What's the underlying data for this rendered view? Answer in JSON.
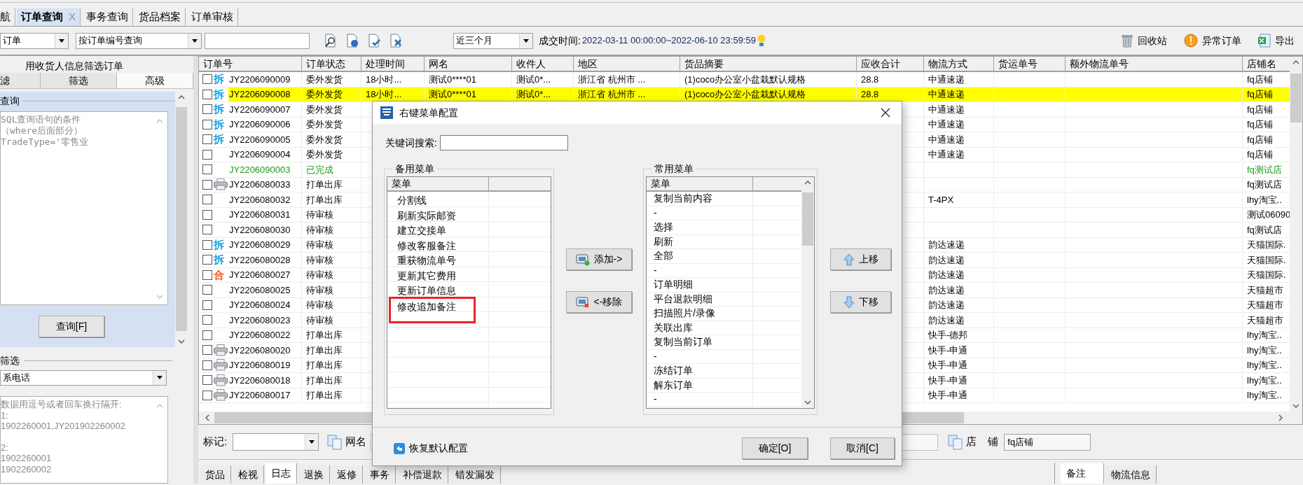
{
  "tabs": [
    {
      "label": "航",
      "selected": false
    },
    {
      "label": "订单查询",
      "selected": true,
      "close": "X"
    },
    {
      "label": "事务查询",
      "selected": false
    },
    {
      "label": "货品档案",
      "selected": false
    },
    {
      "label": "订单审核",
      "selected": false
    }
  ],
  "toolbar": {
    "scope": "订单",
    "query_mode": "按订单编号查询",
    "period": "近三个月",
    "time_label": "成交时间:",
    "time_range": "2022-03-11 00:00:00~2022-06-10 23:59:59",
    "actions": [
      {
        "kind": "trash",
        "label": "回收站"
      },
      {
        "kind": "warning",
        "label": "异常订单"
      },
      {
        "kind": "export",
        "label": "导出"
      }
    ]
  },
  "filter_panel": {
    "title": "用收货人信息筛选订单",
    "tabs": [
      {
        "label": "滤",
        "selected": false
      },
      {
        "label": "筛选",
        "selected": false
      },
      {
        "label": "高级",
        "selected": true
      }
    ],
    "query_title": "查询",
    "query_hint": [
      "SQL查询语句的条件",
      "（where后面部分）",
      "TradeType='零售业"
    ],
    "query_button": "查询[F]",
    "filter_title": "筛选",
    "filter_field": "系电话",
    "filter_hint": [
      [
        "数据用逗号或者回车换行隔开:",
        "1:",
        "1902260001,JY201902260002"
      ],
      [
        "2:",
        "1902260001",
        "1902260002"
      ]
    ]
  },
  "table": {
    "columns": [
      "订单号",
      "订单状态",
      "处理时间",
      "网名",
      "收件人",
      "地区",
      "货品摘要",
      "应收合计",
      "物流方式",
      "货运单号",
      "额外物流单号",
      "店铺名"
    ],
    "rows": [
      {
        "checked": false,
        "selected": false,
        "printed": false,
        "completed": false,
        "tag": {
          "text": "拆",
          "color": "#1ba1e2"
        },
        "order_no": "JY2206090009",
        "status": "委外发货",
        "time": "18小时...",
        "nickname": "测试0****01",
        "receiver": "测试0*...",
        "region": "浙江省 杭州市 ...",
        "goods": "(1)coco办公室小盆栽默认规格",
        "amount": "28.8",
        "shipping": "中通速递",
        "store": "fq店铺"
      },
      {
        "checked": false,
        "selected": true,
        "printed": false,
        "completed": false,
        "tag": {
          "text": "拆",
          "color": "#1ba1e2"
        },
        "order_no": "JY2206090008",
        "status": "委外发货",
        "time": "18小时...",
        "nickname": "测试0****01",
        "receiver": "测试0*...",
        "region": "浙江省 杭州市 ...",
        "goods": "(1)coco办公室小盆栽默认规格",
        "amount": "28.8",
        "shipping": "中通速递",
        "store": "fq店铺"
      },
      {
        "checked": false,
        "selected": false,
        "printed": false,
        "completed": false,
        "tag": {
          "text": "拆",
          "color": "#1ba1e2"
        },
        "order_no": "JY2206090007",
        "status": "委外发货",
        "shipping": "中通速递",
        "store": "fq店铺"
      },
      {
        "checked": false,
        "selected": false,
        "printed": false,
        "completed": false,
        "tag": {
          "text": "拆",
          "color": "#1ba1e2"
        },
        "order_no": "JY2206090006",
        "status": "委外发货",
        "shipping": "中通速递",
        "store": "fq店铺"
      },
      {
        "checked": false,
        "selected": false,
        "printed": false,
        "completed": false,
        "tag": {
          "text": "拆",
          "color": "#1ba1e2"
        },
        "order_no": "JY2206090005",
        "status": "委外发货",
        "shipping": "中通速递",
        "store": "fq店铺"
      },
      {
        "checked": false,
        "selected": false,
        "printed": false,
        "completed": false,
        "order_no": "JY2206090004",
        "status": "委外发货",
        "shipping": "中通速递",
        "store": "fq店铺"
      },
      {
        "checked": false,
        "selected": false,
        "printed": false,
        "completed": true,
        "order_no": "JY2206090003",
        "status": "已完成",
        "store": "fq测试店"
      },
      {
        "checked": false,
        "selected": false,
        "printed": true,
        "completed": false,
        "order_no": "JY2206080033",
        "status": "打单出库",
        "store": "fq测试店"
      },
      {
        "checked": false,
        "selected": false,
        "printed": false,
        "completed": false,
        "order_no": "JY2206080032",
        "status": "打单出库",
        "shipping": "T-4PX",
        "store": "lhy淘宝.."
      },
      {
        "checked": false,
        "selected": false,
        "printed": false,
        "completed": false,
        "order_no": "JY2206080031",
        "status": "待审核",
        "store": "测试06090"
      },
      {
        "checked": false,
        "selected": false,
        "printed": false,
        "completed": false,
        "order_no": "JY2206080030",
        "status": "待审核",
        "store": "fq测试店"
      },
      {
        "checked": false,
        "selected": false,
        "printed": false,
        "completed": false,
        "tag": {
          "text": "拆",
          "color": "#1ba1e2"
        },
        "order_no": "JY2206080029",
        "status": "待审核",
        "shipping": "韵达速递",
        "store": "天猫国际."
      },
      {
        "checked": false,
        "selected": false,
        "printed": false,
        "completed": false,
        "tag": {
          "text": "拆",
          "color": "#1ba1e2"
        },
        "order_no": "JY2206080028",
        "status": "待审核",
        "shipping": "韵达速递",
        "store": "天猫国际."
      },
      {
        "checked": false,
        "selected": false,
        "printed": false,
        "completed": false,
        "tag": {
          "text": "合",
          "color": "#f05a28"
        },
        "order_no": "JY2206080027",
        "status": "待审核",
        "shipping": "韵达速递",
        "store": "天猫国际."
      },
      {
        "checked": false,
        "selected": false,
        "printed": false,
        "completed": false,
        "order_no": "JY2206080025",
        "status": "待审核",
        "shipping": "韵达速递",
        "store": "天猫超市"
      },
      {
        "checked": false,
        "selected": false,
        "printed": false,
        "completed": false,
        "order_no": "JY2206080024",
        "status": "待审核",
        "shipping": "韵达速递",
        "store": "天猫超市"
      },
      {
        "checked": false,
        "selected": false,
        "printed": false,
        "completed": false,
        "order_no": "JY2206080023",
        "status": "待审核",
        "shipping": "韵达速递",
        "store": "天猫超市"
      },
      {
        "checked": false,
        "selected": false,
        "printed": false,
        "completed": false,
        "order_no": "JY2206080022",
        "status": "打单出库",
        "shipping": "快手-德邦",
        "store": "lhy淘宝.."
      },
      {
        "checked": false,
        "selected": false,
        "printed": true,
        "completed": false,
        "order_no": "JY2206080020",
        "status": "打单出库",
        "shipping": "快手-申通",
        "store": "lhy淘宝.."
      },
      {
        "checked": false,
        "selected": false,
        "printed": true,
        "completed": false,
        "order_no": "JY2206080019",
        "status": "打单出库",
        "shipping": "快手-申通",
        "store": "lhy淘宝.."
      },
      {
        "checked": false,
        "selected": false,
        "printed": true,
        "completed": false,
        "order_no": "JY2206080018",
        "status": "打单出库",
        "shipping": "快手-申通",
        "store": "lhy淘宝.."
      },
      {
        "checked": false,
        "selected": false,
        "printed": true,
        "completed": false,
        "order_no": "JY2206080017",
        "status": "打单出库",
        "shipping": "快手-申通",
        "store": "lhy淘宝.."
      }
    ]
  },
  "detail_bar": {
    "mark_label": "标记:",
    "nickname_label": "网名",
    "store_label": "店 铺",
    "store_value": "fq店铺"
  },
  "bottom_tabs": [
    {
      "label": "货品",
      "selected": false
    },
    {
      "label": "检视",
      "selected": false
    },
    {
      "label": "日志",
      "selected": true
    },
    {
      "label": "退换",
      "selected": false
    },
    {
      "label": "返修",
      "selected": false
    },
    {
      "label": "事务",
      "selected": false
    },
    {
      "label": "补偿退款",
      "selected": false
    },
    {
      "label": "错发漏发",
      "selected": false
    }
  ],
  "side_tabs": [
    {
      "label": "备注",
      "selected": true
    },
    {
      "label": "物流信息",
      "selected": false
    }
  ],
  "dialog": {
    "title": "右键菜单配置",
    "keyword_label": "关键词搜索:",
    "spare_title": "备用菜单",
    "spare_header": "菜单",
    "spare_items": [
      {
        "label": "分割线",
        "highlighted": false
      },
      {
        "label": "刷新实际邮资",
        "highlighted": false
      },
      {
        "label": "建立交接单",
        "highlighted": false
      },
      {
        "label": "修改客服备注",
        "highlighted": false
      },
      {
        "label": "重获物流单号",
        "highlighted": false
      },
      {
        "label": "更新其它费用",
        "highlighted": false
      },
      {
        "label": "更新订单信息",
        "highlighted": false
      },
      {
        "label": "修改追加备注",
        "highlighted": true
      }
    ],
    "transfer_buttons": [
      {
        "kind": "add",
        "label": "添加->"
      },
      {
        "kind": "remove",
        "label": "<-移除"
      }
    ],
    "common_title": "常用菜单",
    "common_header": "菜单",
    "common_items": [
      "复制当前内容",
      "-",
      "选择",
      "刷新",
      "全部",
      "-",
      "订单明细",
      "平台退款明细",
      "扫描照片/录像",
      "关联出库",
      "复制当前订单",
      "-",
      "冻结订单",
      "解东订单",
      "-"
    ],
    "order_buttons": [
      {
        "kind": "up",
        "label": "上移"
      },
      {
        "kind": "down",
        "label": "下移"
      }
    ],
    "restore_link": "恢复默认配置",
    "ok_button": "确定[O]",
    "cancel_button": "取消[C]"
  }
}
